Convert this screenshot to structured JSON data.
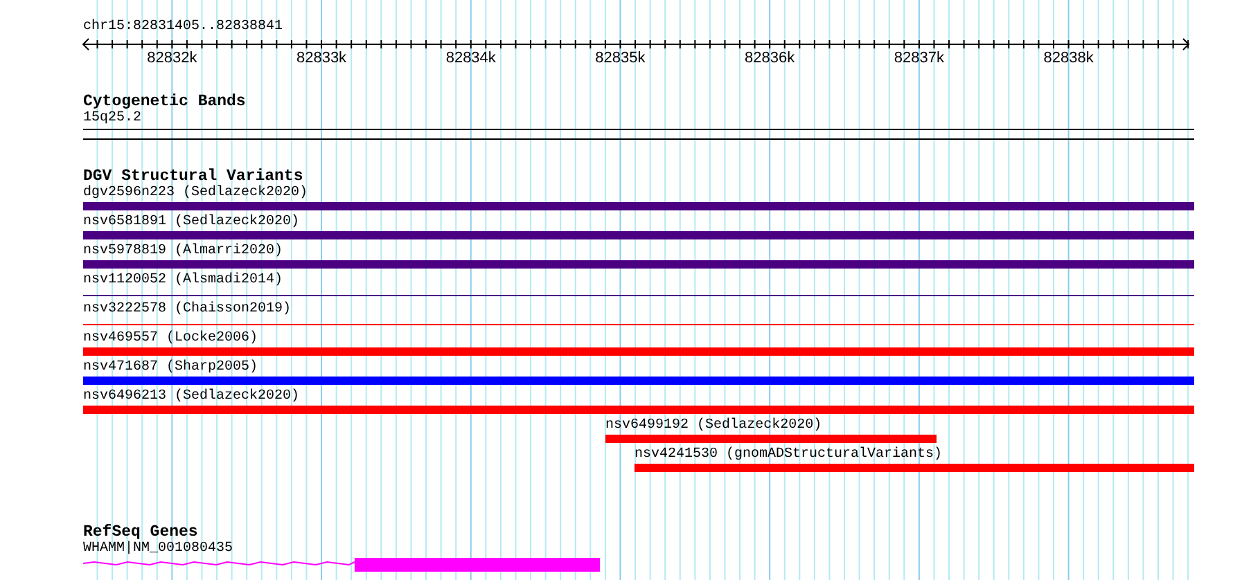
{
  "ruler": {
    "location": "chr15:82831405..82838841",
    "ticks": [
      {
        "label": "82832k"
      },
      {
        "label": "82833k"
      },
      {
        "label": "82834k"
      },
      {
        "label": "82835k"
      },
      {
        "label": "82836k"
      },
      {
        "label": "82837k"
      },
      {
        "label": "82838k"
      }
    ]
  },
  "tracks": [
    {
      "kind": "cytoband",
      "title": "Cytogenetic Bands",
      "features": [
        {
          "label": "15q25.2"
        }
      ]
    },
    {
      "kind": "variants",
      "title": "DGV Structural Variants",
      "features": [
        {
          "label": "dgv2596n223 (Sedlazeck2020)",
          "kind": "thick",
          "color": "#4b0082"
        },
        {
          "label": "nsv6581891 (Sedlazeck2020)",
          "kind": "thick",
          "color": "#4b0082"
        },
        {
          "label": "nsv5978819 (Almarri2020)",
          "kind": "thick",
          "color": "#4b0082"
        },
        {
          "label": "nsv1120052 (Alsmadi2014)",
          "kind": "thin",
          "color": "#4b0082"
        },
        {
          "label": "nsv3222578 (Chaisson2019)",
          "kind": "thin",
          "color": "#ff0000"
        },
        {
          "label": "nsv469557 (Locke2006)",
          "kind": "thick",
          "color": "#ff0000"
        },
        {
          "label": "nsv471687 (Sharp2005)",
          "kind": "thick",
          "color": "#0000ff"
        },
        {
          "label": "nsv6496213 (Sedlazeck2020)",
          "kind": "thick",
          "color": "#ff0000"
        },
        {
          "label": "nsv6499192 (Sedlazeck2020)",
          "kind": "thick",
          "color": "#ff0000"
        },
        {
          "label": "nsv4241530 (gnomADStructuralVariants)",
          "kind": "thick",
          "color": "#ff0000"
        }
      ]
    },
    {
      "kind": "genes",
      "title": "RefSeq Genes",
      "features": [
        {
          "label": "WHAMM|NM_001080435",
          "color": "#ff00ff"
        }
      ]
    }
  ]
}
